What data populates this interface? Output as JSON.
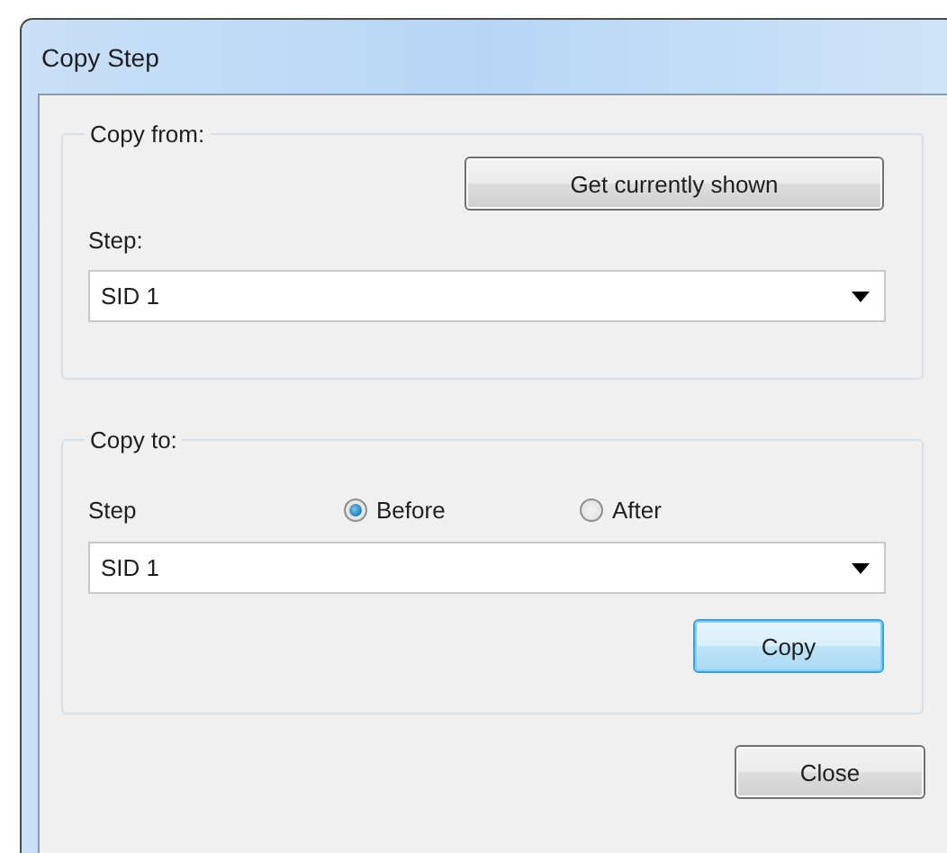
{
  "window": {
    "title": "Copy Step"
  },
  "copy_from": {
    "legend": "Copy from:",
    "button": "Get currently shown",
    "step_label": "Step:",
    "step_value": "SID 1"
  },
  "copy_to": {
    "legend": "Copy to:",
    "step_label": "Step",
    "positions": [
      {
        "label": "Before",
        "selected": true
      },
      {
        "label": "After",
        "selected": false
      }
    ],
    "step_value": "SID 1",
    "button": "Copy",
    "button_focused": true
  },
  "buttons": [
    {
      "label": "Close"
    }
  ]
}
